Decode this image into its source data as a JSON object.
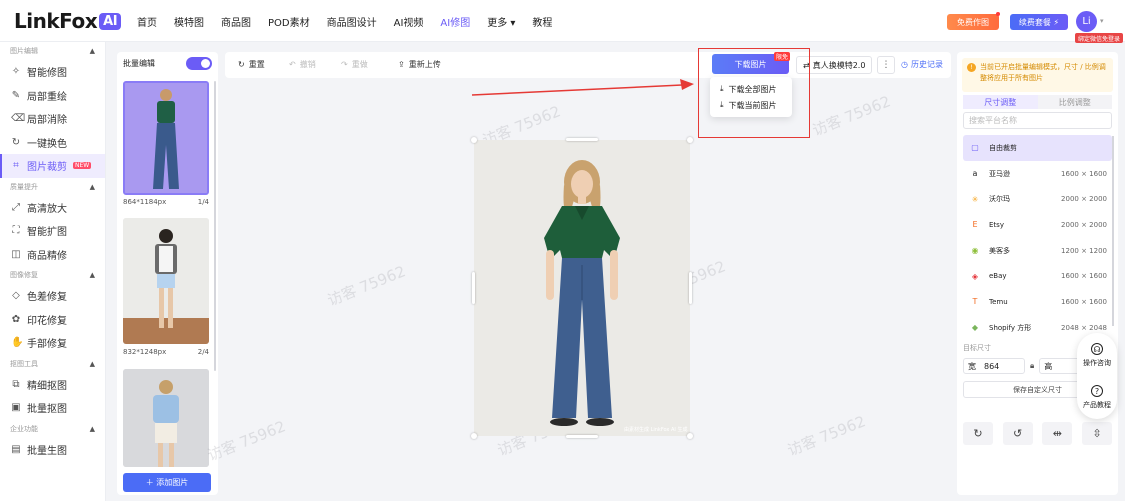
{
  "header": {
    "logo_text": "LinkFox",
    "logo_badge": "AI",
    "nav": [
      "首页",
      "模特图",
      "商品图",
      "POD素材",
      "商品图设计",
      "AI视频",
      "AI修图",
      "更多 ▾",
      "教程"
    ],
    "free_btn": "免费作图",
    "renew_btn": "续费套餐 ⚡",
    "avatar": "Li",
    "user_tag": "绑定微信免登录"
  },
  "sidebar": {
    "sections": [
      {
        "title": "图片编辑",
        "items": [
          {
            "icon": "✧",
            "label": "智能修图"
          },
          {
            "icon": "✎",
            "label": "局部重绘"
          },
          {
            "icon": "⌫",
            "label": "局部消除"
          },
          {
            "icon": "↻",
            "label": "一键换色"
          },
          {
            "icon": "⌗",
            "label": "图片裁剪",
            "badge": "NEW",
            "active": true
          }
        ]
      },
      {
        "title": "质量提升",
        "items": [
          {
            "icon": "⤢",
            "label": "高清放大"
          },
          {
            "icon": "⛶",
            "label": "智能扩图"
          },
          {
            "icon": "◫",
            "label": "商品精修"
          }
        ]
      },
      {
        "title": "图像修复",
        "items": [
          {
            "icon": "◇",
            "label": "色差修复"
          },
          {
            "icon": "✿",
            "label": "印花修复"
          },
          {
            "icon": "✋",
            "label": "手部修复"
          }
        ]
      },
      {
        "title": "抠图工具",
        "items": [
          {
            "icon": "⧉",
            "label": "精细抠图"
          },
          {
            "icon": "▣",
            "label": "批量抠图"
          }
        ]
      },
      {
        "title": "企业功能",
        "items": [
          {
            "icon": "▤",
            "label": "批量生图"
          }
        ]
      }
    ]
  },
  "batch": {
    "title": "批量编辑",
    "items": [
      {
        "size": "864*1184px",
        "index": "1/4"
      },
      {
        "size": "832*1248px",
        "index": "2/4"
      }
    ],
    "add_label": "＋ 添加图片"
  },
  "toolbar": {
    "reset": "重置",
    "undo": "撤销",
    "redo": "重做",
    "reupload": "重新上传",
    "download": "下载图片",
    "download_badge": "限免",
    "model_swap": "真人换模特2.0",
    "history": "历史记录"
  },
  "dropdown": {
    "all": "下载全部图片",
    "current": "下载当前图片"
  },
  "canvas": {
    "watermark": "访客 75962",
    "image_caption": "由素材生成 LinkFox AI 生成"
  },
  "rpanel": {
    "notice": "当前已开启批量编辑模式，尺寸 / 比例调整将应用于所有图片",
    "tab_size": "尺寸调整",
    "tab_ratio": "比例调整",
    "search_placeholder": "搜索平台名称",
    "platforms": [
      {
        "icon": "▢",
        "name": "自由裁剪",
        "size": "",
        "color": "#6b5cf6"
      },
      {
        "icon": "a",
        "name": "亚马逊",
        "size": "1600 × 1600",
        "color": "#222"
      },
      {
        "icon": "✳",
        "name": "沃尔玛",
        "size": "2000 × 2000",
        "color": "#f5a623"
      },
      {
        "icon": "E",
        "name": "Etsy",
        "size": "2000 × 2000",
        "color": "#f26b21"
      },
      {
        "icon": "◉",
        "name": "美客多",
        "size": "1200 × 1200",
        "color": "#8fbf3c"
      },
      {
        "icon": "◈",
        "name": "eBay",
        "size": "1600 × 1600",
        "color": "#e53238"
      },
      {
        "icon": "T",
        "name": "Temu",
        "size": "1600 × 1600",
        "color": "#f26b21"
      },
      {
        "icon": "◆",
        "name": "Shopify 方形",
        "size": "2048 × 2048",
        "color": "#7ab55c"
      }
    ],
    "target_label": "目标尺寸",
    "width_label": "宽",
    "width_value": "864",
    "height_label": "高",
    "save_label": "保存自定义尺寸"
  },
  "float": {
    "consult": "操作咨询",
    "tutorial": "产品教程"
  },
  "colors": {
    "accent": "#6b5cf6",
    "primary_blue": "#4b6cf6",
    "annotation_red": "#e53935"
  }
}
